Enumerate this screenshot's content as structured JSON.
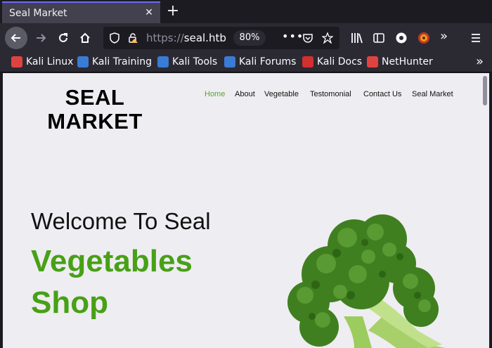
{
  "browser": {
    "tab_title": "Seal Market",
    "url_scheme": "https://",
    "url_host": "seal.htb",
    "zoom": "80%",
    "more_dots": "•••"
  },
  "bookmarks": [
    {
      "label": "Kali Linux",
      "color": "#e0433f"
    },
    {
      "label": "Kali Training",
      "color": "#3a7bd5"
    },
    {
      "label": "Kali Tools",
      "color": "#3a7bd5"
    },
    {
      "label": "Kali Forums",
      "color": "#3a7bd5"
    },
    {
      "label": "Kali Docs",
      "color": "#d32f2f"
    },
    {
      "label": "NetHunter",
      "color": "#e0433f"
    }
  ],
  "site": {
    "logo_line1": "SEAL",
    "logo_line2": "MARKET",
    "nav": {
      "home": "Home",
      "about": "About",
      "vegetable": "Vegetable",
      "testimonial": "Testomonial",
      "contact": "Contact Us",
      "market": "Seal Market"
    },
    "welcome": "Welcome To Seal",
    "hero_line1": "Vegetables",
    "hero_line2": "Shop"
  },
  "colors": {
    "accent_green": "#48a017",
    "nav_active": "#58a62a",
    "page_bg": "#eeedf1"
  }
}
